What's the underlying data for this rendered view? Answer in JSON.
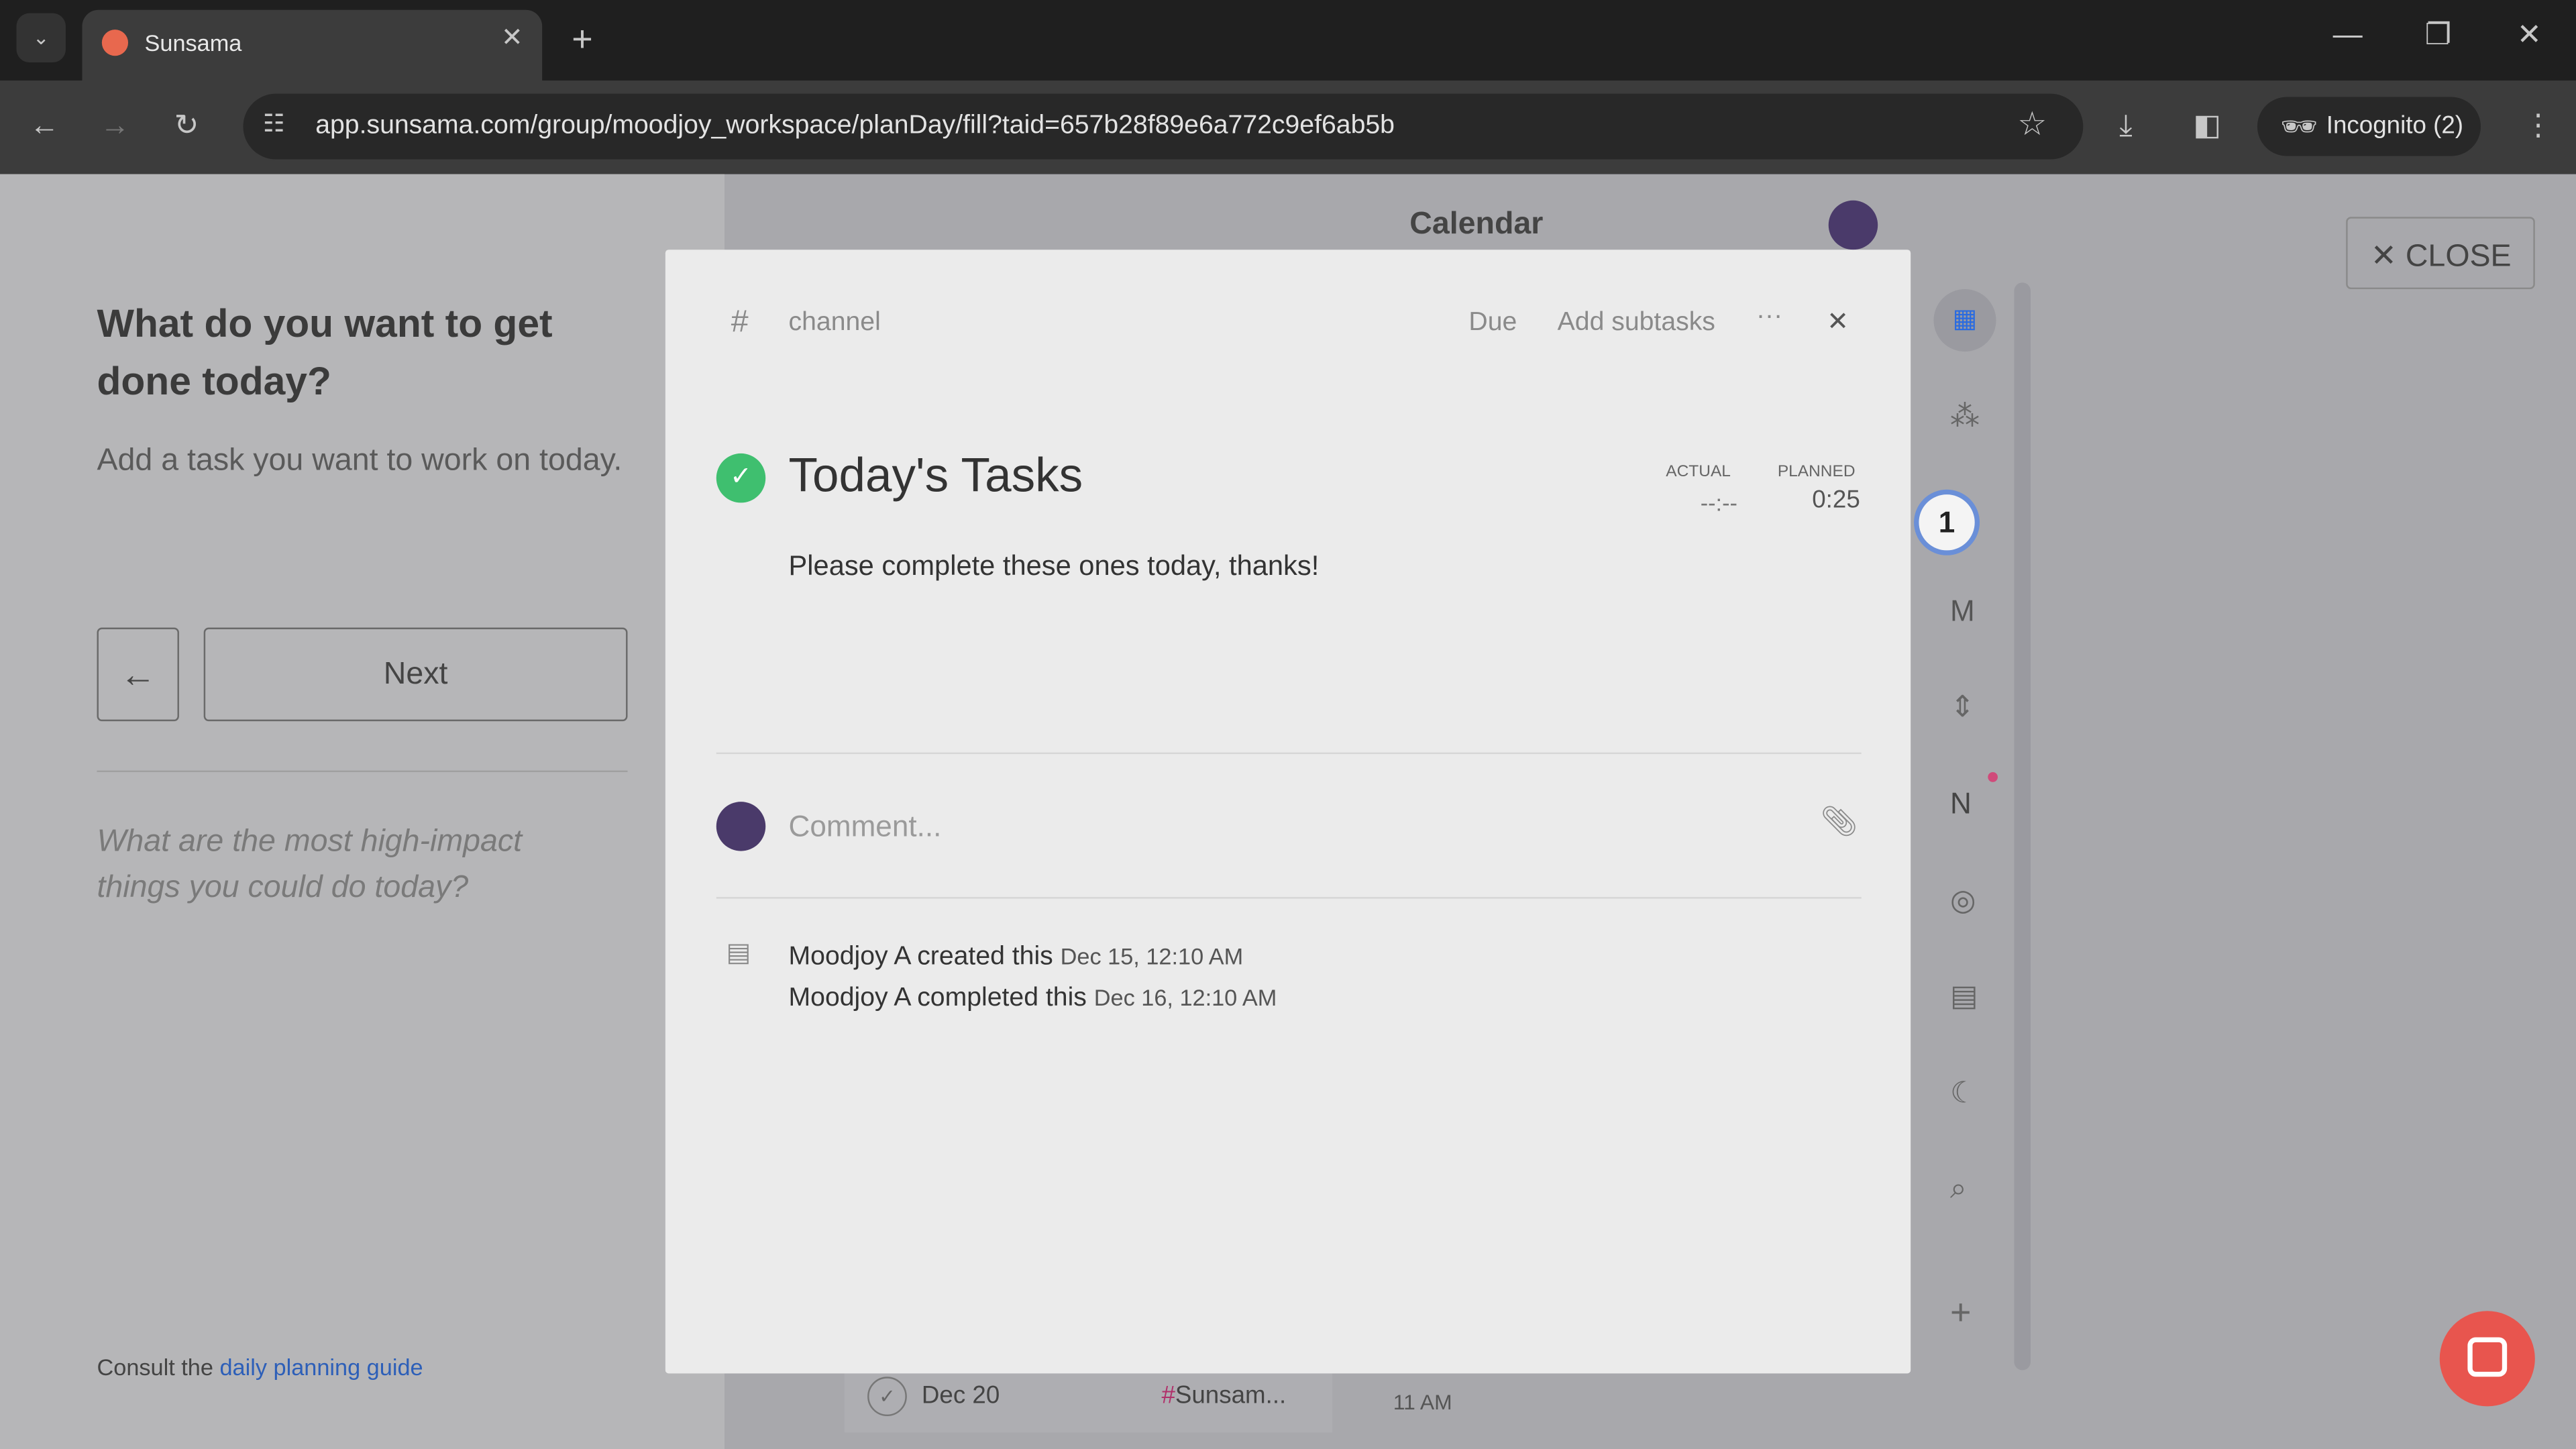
{
  "browser": {
    "tab_title": "Sunsama",
    "url": "app.sunsama.com/group/moodjoy_workspace/planDay/fill?taid=657b28f89e6a772c9ef6ab5b",
    "profile": "Incognito (2)"
  },
  "left": {
    "heading": "What do you want to get done today?",
    "sub": "Add a task you want to work on today.",
    "next": "Next",
    "prompt": "What are the most high-impact things you could do today?",
    "consult": "Consult the ",
    "guide": "daily planning guide"
  },
  "calendar": {
    "title": "Calendar",
    "close": "CLOSE",
    "row_date": "Dec 20",
    "row_channel": "Sunsam...",
    "row_time": "11 AM"
  },
  "modal": {
    "channel": "channel",
    "due": "Due",
    "add_subtasks": "Add subtasks",
    "title": "Today's Tasks",
    "actual_label": "ACTUAL",
    "actual_value": "--:--",
    "planned_label": "PLANNED",
    "planned_value": "0:25",
    "notes": "Please complete these ones today, thanks!",
    "comment_placeholder": "Comment...",
    "activity": [
      {
        "text": "Moodjoy A created this",
        "time": "Dec 15, 12:10 AM"
      },
      {
        "text": "Moodjoy A completed this",
        "time": "Dec 16, 12:10 AM"
      }
    ]
  },
  "badge": "1",
  "colors": {
    "accent_green": "#3fbf6f",
    "intercom": "#e8554e",
    "link": "#3b6fd1"
  }
}
